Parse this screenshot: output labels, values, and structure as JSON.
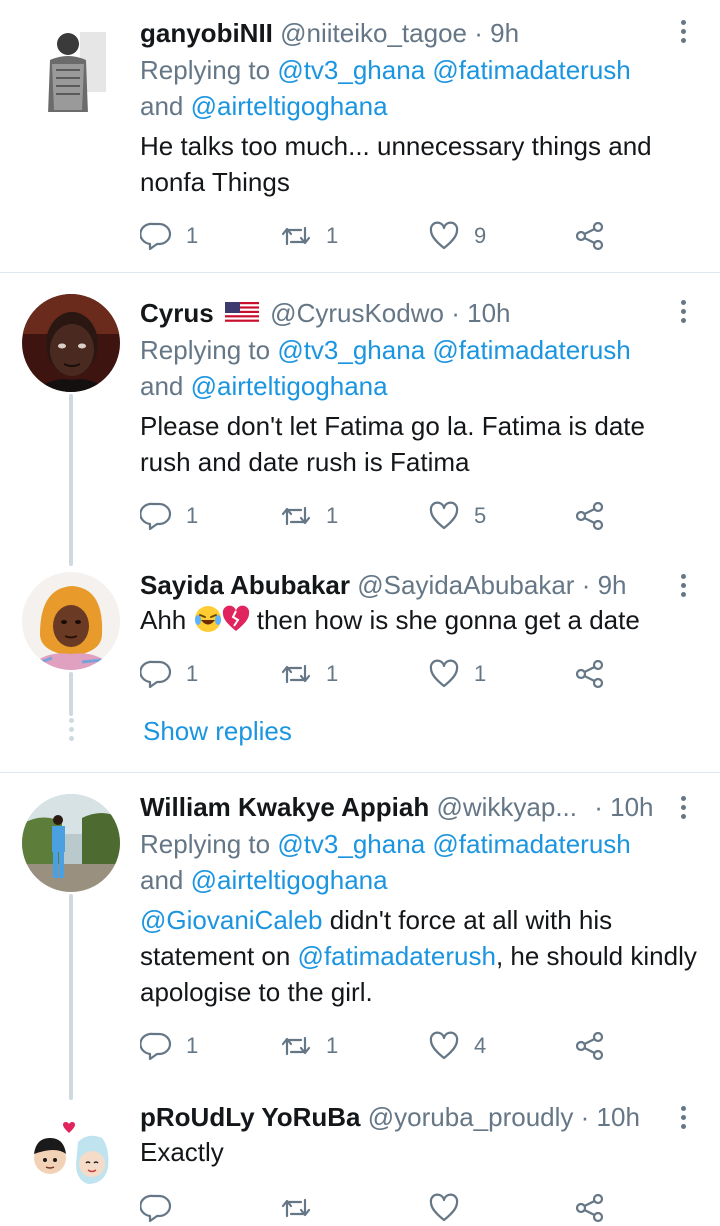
{
  "icons": {
    "reply": "reply-icon",
    "retweet": "retweet-icon",
    "like": "heart-icon",
    "share": "share-icon",
    "more": "more-vertical-icon"
  },
  "colors": {
    "link": "#1b95e0",
    "muted": "#657786",
    "thread_line": "#cfd9de",
    "divider": "#e1e8ed"
  },
  "tweets": [
    {
      "name": "ganyobiNII",
      "handle": "@niiteiko_tagoe",
      "sep": "·",
      "time": "9h",
      "replying_prefix": "Replying to",
      "replying_line1": "@tv3_ghana @fatimadaterush",
      "and": "and",
      "replying_line2": "@airteltigoghana",
      "body": "He talks too much... unnecessary things and nonfa Things",
      "replies": "1",
      "retweets": "1",
      "likes": "9"
    },
    {
      "name": "Cyrus",
      "flag": "us-flag-emoji",
      "handle": "@CyrusKodwo",
      "sep": "·",
      "time": "10h",
      "replying_prefix": "Replying to",
      "replying_line1": "@tv3_ghana @fatimadaterush",
      "and": "and",
      "replying_line2": "@airteltigoghana",
      "body": "Please don't let Fatima go la. Fatima is date rush and date rush is Fatima",
      "replies": "1",
      "retweets": "1",
      "likes": "5"
    },
    {
      "name": "Sayida Abubakar",
      "handle": "@SayidaAbubakar",
      "sep": "·",
      "time": "9h",
      "body_prefix": "Ahh",
      "body_suffix": "then how is she gonna get a date",
      "replies": "1",
      "retweets": "1",
      "likes": "1"
    },
    {
      "name": "William Kwakye Appiah",
      "handle": "@wikkyap...",
      "sep": "·",
      "time": "10h",
      "replying_prefix": "Replying to",
      "replying_line1": "@tv3_ghana @fatimadaterush",
      "and": "and",
      "replying_line2": "@airteltigoghana",
      "mention1": "@GiovaniCaleb",
      "body_part1": " didn't force at all with his statement on ",
      "mention2": "@fatimadaterush",
      "body_part2": ", he should kindly apologise to the girl.",
      "replies": "1",
      "retweets": "1",
      "likes": "4"
    },
    {
      "name": "pRoUdLy YoRuBa",
      "handle": "@yoruba_proudly",
      "sep": "·",
      "time": "10h",
      "body": "Exactly"
    }
  ],
  "show_replies": "Show replies"
}
